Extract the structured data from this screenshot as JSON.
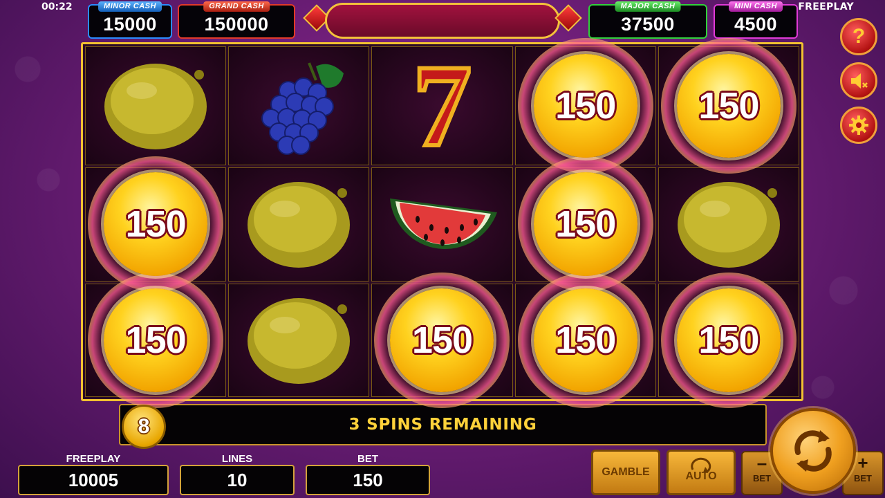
{
  "status": {
    "clock": "00:22",
    "mode": "FREEPLAY"
  },
  "jackpots": {
    "minor": {
      "label": "MINOR CASH",
      "value": "15000"
    },
    "grand": {
      "label": "GRAND CASH",
      "value": "150000"
    },
    "major": {
      "label": "MAJOR CASH",
      "value": "37500"
    },
    "mini": {
      "label": "MINI CASH",
      "value": "4500"
    }
  },
  "side_buttons": {
    "help": "?",
    "sound_icon": "speaker-muted-icon",
    "settings_icon": "gear-icon"
  },
  "reels": {
    "rows": [
      [
        {
          "type": "lemon"
        },
        {
          "type": "grapes"
        },
        {
          "type": "seven",
          "text": "7"
        },
        {
          "type": "coin",
          "value": "150"
        },
        {
          "type": "coin",
          "value": "150"
        }
      ],
      [
        {
          "type": "coin",
          "value": "150"
        },
        {
          "type": "lemon"
        },
        {
          "type": "watermelon"
        },
        {
          "type": "coin",
          "value": "150"
        },
        {
          "type": "lemon"
        }
      ],
      [
        {
          "type": "coin",
          "value": "150"
        },
        {
          "type": "lemon"
        },
        {
          "type": "coin",
          "value": "150"
        },
        {
          "type": "coin",
          "value": "150"
        },
        {
          "type": "coin",
          "value": "150"
        }
      ]
    ]
  },
  "info_bar": {
    "counter": "8",
    "message": "3 SPINS REMAINING"
  },
  "fields": {
    "freeplay": {
      "label": "FREEPLAY",
      "value": "10005"
    },
    "lines": {
      "label": "LINES",
      "value": "10"
    },
    "bet": {
      "label": "BET",
      "value": "150"
    }
  },
  "controls": {
    "gamble": "GAMBLE",
    "auto": "AUTO",
    "bet_minus_sign": "–",
    "bet_minus_label": "BET",
    "bet_plus_sign": "+",
    "bet_plus_label": "BET"
  }
}
